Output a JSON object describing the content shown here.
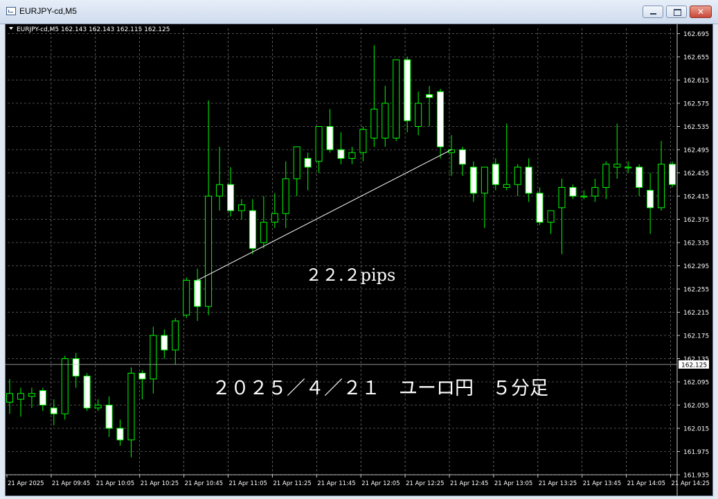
{
  "window": {
    "title": "EURJPY-cd,M5",
    "icon": "chart-window-icon",
    "buttons": {
      "minimize": "minimize-icon",
      "maximize": "maximize-icon",
      "close": "✕"
    }
  },
  "chart_header": "EURJPY-cd,M5  162.143 162.143 162.115 162.125",
  "annotations": {
    "pips": "２２.２pips",
    "caption": "２０２５／４／２１　ユーロ円　５分足"
  },
  "colors": {
    "background": "#000000",
    "grid": "#9a9a9a",
    "candle": "#00ff00",
    "bull_body": "#000000",
    "bear_body": "#ffffff"
  },
  "chart_data": {
    "type": "candlestick",
    "symbol": "EURJPY-cd",
    "timeframe": "M5",
    "bid_price": "162.125",
    "y_ticks": [
      "162.695",
      "162.655",
      "162.615",
      "162.575",
      "162.535",
      "162.495",
      "162.455",
      "162.415",
      "162.375",
      "162.335",
      "162.295",
      "162.255",
      "162.215",
      "162.175",
      "162.135",
      "162.095",
      "162.055",
      "162.015",
      "161.975",
      "161.935"
    ],
    "ylim": [
      161.935,
      162.695
    ],
    "x_labels": [
      "21 Apr 2025",
      "21 Apr 09:45",
      "21 Apr 10:05",
      "21 Apr 10:25",
      "21 Apr 10:45",
      "21 Apr 11:05",
      "21 Apr 11:25",
      "21 Apr 11:45",
      "21 Apr 12:05",
      "21 Apr 12:25",
      "21 Apr 12:45",
      "21 Apr 13:05",
      "21 Apr 13:25",
      "21 Apr 13:45",
      "21 Apr 14:05",
      "21 Apr 14:25"
    ],
    "candles": [
      [
        162.06,
        162.1,
        162.04,
        162.075
      ],
      [
        162.065,
        162.085,
        162.035,
        162.075
      ],
      [
        162.07,
        162.085,
        162.05,
        162.075
      ],
      [
        162.08,
        162.085,
        162.045,
        162.055
      ],
      [
        162.05,
        162.065,
        162.02,
        162.04
      ],
      [
        162.04,
        162.14,
        162.03,
        162.135
      ],
      [
        162.135,
        162.145,
        162.085,
        162.105
      ],
      [
        162.105,
        162.11,
        162.045,
        162.05
      ],
      [
        162.05,
        162.065,
        162.045,
        162.055
      ],
      [
        162.055,
        162.07,
        162.0,
        162.015
      ],
      [
        162.015,
        162.03,
        161.985,
        161.995
      ],
      [
        161.995,
        162.12,
        161.965,
        162.11
      ],
      [
        162.11,
        162.115,
        162.065,
        162.1
      ],
      [
        162.1,
        162.19,
        162.075,
        162.175
      ],
      [
        162.175,
        162.185,
        162.135,
        162.15
      ],
      [
        162.15,
        162.205,
        162.125,
        162.2
      ],
      [
        162.21,
        162.275,
        162.205,
        162.27
      ],
      [
        162.27,
        162.29,
        162.2,
        162.225
      ],
      [
        162.225,
        162.58,
        162.21,
        162.415
      ],
      [
        162.415,
        162.5,
        162.39,
        162.435
      ],
      [
        162.435,
        162.465,
        162.38,
        162.39
      ],
      [
        162.39,
        162.41,
        162.375,
        162.4
      ],
      [
        162.39,
        162.41,
        162.315,
        162.325
      ],
      [
        162.335,
        162.415,
        162.325,
        162.37
      ],
      [
        162.37,
        162.42,
        162.36,
        162.385
      ],
      [
        162.385,
        162.475,
        162.36,
        162.445
      ],
      [
        162.445,
        162.485,
        162.415,
        162.5
      ],
      [
        162.48,
        162.49,
        162.425,
        162.465
      ],
      [
        162.475,
        162.495,
        162.455,
        162.535
      ],
      [
        162.535,
        162.565,
        162.49,
        162.495
      ],
      [
        162.495,
        162.525,
        162.47,
        162.48
      ],
      [
        162.48,
        162.5,
        162.47,
        162.49
      ],
      [
        162.49,
        162.535,
        162.475,
        162.53
      ],
      [
        162.515,
        162.675,
        162.5,
        162.565
      ],
      [
        162.515,
        162.605,
        162.5,
        162.575
      ],
      [
        162.515,
        162.615,
        162.51,
        162.65
      ],
      [
        162.65,
        162.655,
        162.525,
        162.545
      ],
      [
        162.535,
        162.595,
        162.52,
        162.575
      ],
      [
        162.59,
        162.605,
        162.535,
        162.585
      ],
      [
        162.595,
        162.6,
        162.48,
        162.5
      ],
      [
        162.49,
        162.52,
        162.45,
        162.495
      ],
      [
        162.495,
        162.5,
        162.45,
        162.47
      ],
      [
        162.465,
        162.475,
        162.405,
        162.42
      ],
      [
        162.42,
        162.465,
        162.36,
        162.465
      ],
      [
        162.47,
        162.48,
        162.425,
        162.435
      ],
      [
        162.43,
        162.54,
        162.425,
        162.435
      ],
      [
        162.435,
        162.47,
        162.415,
        162.465
      ],
      [
        162.465,
        162.48,
        162.405,
        162.42
      ],
      [
        162.42,
        162.43,
        162.365,
        162.37
      ],
      [
        162.37,
        162.39,
        162.35,
        162.39
      ],
      [
        162.395,
        162.445,
        162.315,
        162.43
      ],
      [
        162.43,
        162.435,
        162.41,
        162.415
      ],
      [
        162.415,
        162.425,
        162.41,
        162.415
      ],
      [
        162.415,
        162.445,
        162.405,
        162.43
      ],
      [
        162.43,
        162.475,
        162.41,
        162.47
      ],
      [
        162.465,
        162.54,
        162.445,
        162.47
      ],
      [
        162.465,
        162.475,
        162.455,
        162.465
      ],
      [
        162.465,
        162.47,
        162.415,
        162.43
      ],
      [
        162.425,
        162.455,
        162.35,
        162.395
      ],
      [
        162.395,
        162.51,
        162.39,
        162.47
      ],
      [
        162.47,
        162.475,
        162.43,
        162.435
      ]
    ],
    "trendline": {
      "from": [
        17,
        162.27
      ],
      "to": [
        40,
        162.495
      ]
    }
  }
}
